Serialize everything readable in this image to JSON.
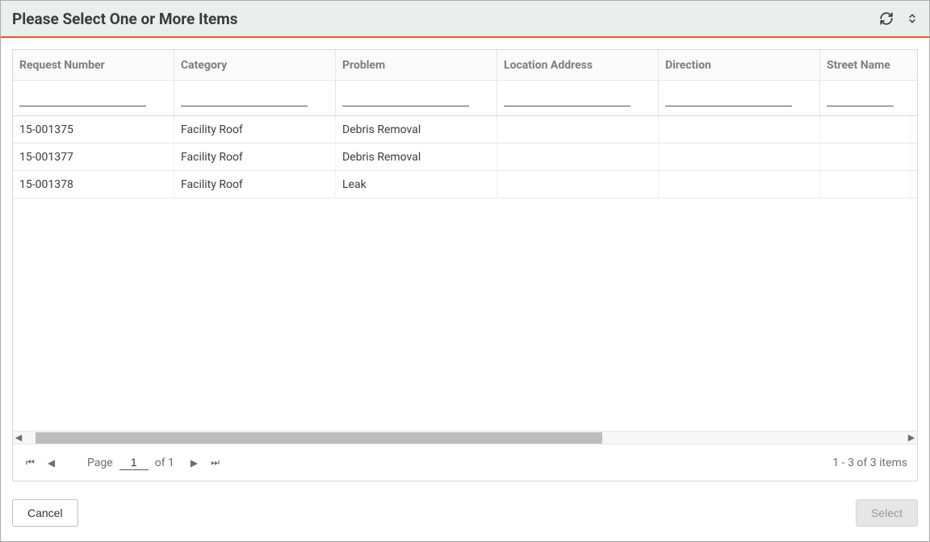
{
  "header": {
    "title": "Please Select One or More Items"
  },
  "grid": {
    "columns": {
      "request_number": "Request Number",
      "category": "Category",
      "problem": "Problem",
      "location_address": "Location Address",
      "direction": "Direction",
      "street_name": "Street Name"
    },
    "filters": {
      "request_number": "",
      "category": "",
      "problem": "",
      "location_address": "",
      "direction": "",
      "street_name": ""
    },
    "rows": [
      {
        "request_number": "15-001375",
        "category": "Facility Roof",
        "problem": "Debris Removal",
        "location_address": "",
        "direction": "",
        "street_name": ""
      },
      {
        "request_number": "15-001377",
        "category": "Facility Roof",
        "problem": "Debris Removal",
        "location_address": "",
        "direction": "",
        "street_name": ""
      },
      {
        "request_number": "15-001378",
        "category": "Facility Roof",
        "problem": "Leak",
        "location_address": "",
        "direction": "",
        "street_name": ""
      }
    ]
  },
  "pager": {
    "page_label": "Page",
    "current_page": "1",
    "of_label": "of 1",
    "range_text": "1 - 3 of 3 items"
  },
  "footer": {
    "cancel_label": "Cancel",
    "select_label": "Select"
  }
}
